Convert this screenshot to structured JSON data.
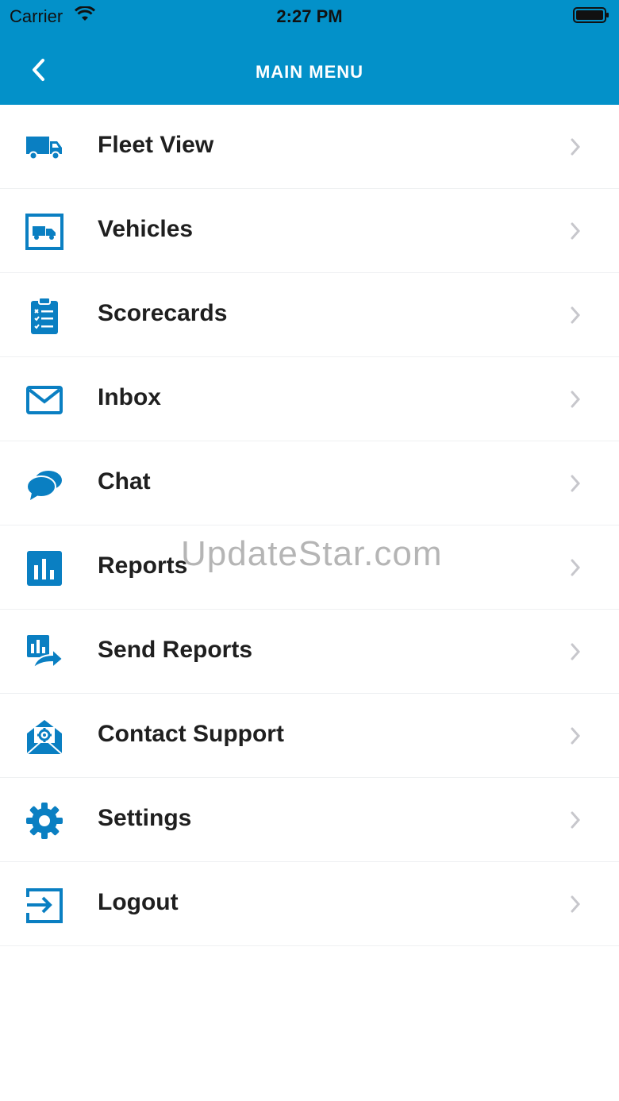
{
  "status_bar": {
    "carrier": "Carrier",
    "time": "2:27 PM"
  },
  "nav_bar": {
    "title": "MAIN MENU",
    "back_icon": "chevron-left-icon"
  },
  "colors": {
    "header": "#0391c9",
    "icon": "#0a7fc2",
    "chevron": "#c7c7cc"
  },
  "menu": {
    "items": [
      {
        "label": "Fleet View",
        "icon": "truck-icon"
      },
      {
        "label": "Vehicles",
        "icon": "vehicle-box-icon"
      },
      {
        "label": "Scorecards",
        "icon": "clipboard-checklist-icon"
      },
      {
        "label": "Inbox",
        "icon": "envelope-icon"
      },
      {
        "label": "Chat",
        "icon": "chat-bubbles-icon"
      },
      {
        "label": "Reports",
        "icon": "bar-chart-icon"
      },
      {
        "label": "Send Reports",
        "icon": "send-report-icon"
      },
      {
        "label": "Contact Support",
        "icon": "support-envelope-gear-icon"
      },
      {
        "label": "Settings",
        "icon": "gear-icon"
      },
      {
        "label": "Logout",
        "icon": "logout-icon"
      }
    ]
  },
  "watermark": "UpdateStar.com"
}
